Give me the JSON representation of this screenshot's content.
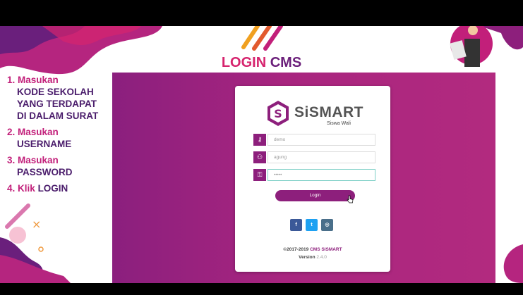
{
  "slide": {
    "title_highlight": "LOGIN",
    "title_rest": "CMS",
    "steps": [
      {
        "num": "1.",
        "lines": [
          "Masukan",
          "KODE SEKOLAH",
          "YANG TERDAPAT",
          "DI DALAM SURAT"
        ]
      },
      {
        "num": "2.",
        "lines": [
          "Masukan",
          "USERNAME"
        ]
      },
      {
        "num": "3.",
        "lines": [
          "Masukan",
          "PASSWORD"
        ]
      },
      {
        "num": "4.",
        "prefix": "Klik",
        "lines": [
          "LOGIN"
        ]
      }
    ]
  },
  "login": {
    "logo_text": "SiSMART",
    "logo_sub": "Siswa Wali",
    "fields": [
      {
        "icon": "key-icon",
        "value": "demo"
      },
      {
        "icon": "user-icon",
        "value": "agung"
      },
      {
        "icon": "lock-icon",
        "value": "•••••"
      }
    ],
    "button": "Login",
    "social": [
      {
        "icon": "facebook-icon",
        "glyph": "f",
        "color": "#3b5998"
      },
      {
        "icon": "twitter-icon",
        "glyph": "t",
        "color": "#1da1f2"
      },
      {
        "icon": "instagram-icon",
        "glyph": "◎",
        "color": "#4a6f8a"
      }
    ],
    "copyright": "©2017-2019",
    "brand": "CMS SISMART",
    "version_label": "Version",
    "version": "2.4.0"
  }
}
